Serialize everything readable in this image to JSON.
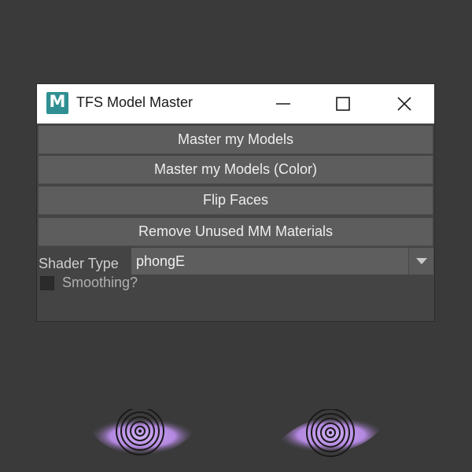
{
  "window": {
    "title": "TFS Model Master",
    "app_icon_letter": "M"
  },
  "buttons": {
    "master_models": "Master my Models",
    "master_models_color": "Master my Models (Color)",
    "flip_faces": "Flip Faces",
    "remove_unused": "Remove Unused MM Materials"
  },
  "shader": {
    "label": "Shader Type",
    "value": "phongE"
  },
  "smoothing": {
    "label": "Smoothing?",
    "checked": false
  },
  "colors": {
    "background": "#3a3a3a",
    "panel": "#444444",
    "button": "#5d5d5d",
    "icon_accent": "#2f8f92",
    "eye_glow": "#b98be8"
  },
  "icons": [
    "maya-logo-icon",
    "minimize-icon",
    "maximize-icon",
    "close-icon",
    "chevron-down-icon"
  ]
}
